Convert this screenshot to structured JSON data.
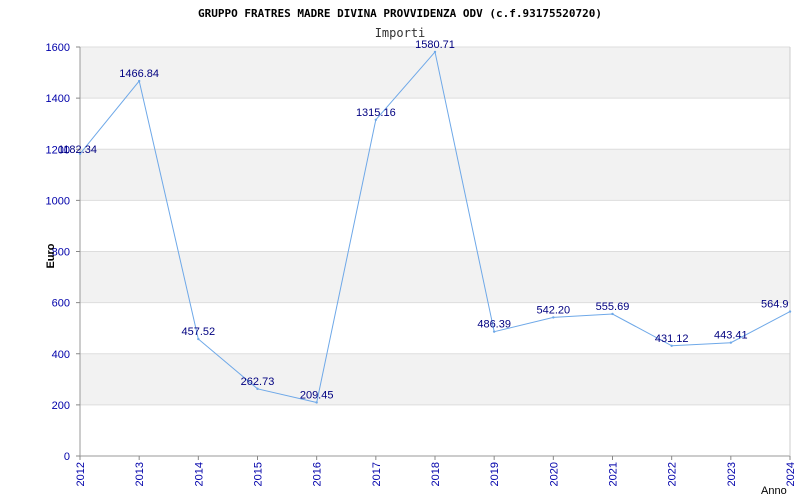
{
  "chart_data": {
    "type": "line",
    "title": "GRUPPO FRATRES MADRE DIVINA PROVVIDENZA ODV (c.f.93175520720)",
    "subtitle": "Importi",
    "xlabel": "Anno",
    "ylabel": "Euro",
    "ylim": [
      0,
      1600
    ],
    "yticks": [
      0,
      200,
      400,
      600,
      800,
      1000,
      1200,
      1400,
      1600
    ],
    "categories": [
      "2012",
      "2013",
      "2014",
      "2015",
      "2016",
      "2017",
      "2018",
      "2019",
      "2020",
      "2021",
      "2022",
      "2023",
      "2024"
    ],
    "values": [
      1182.34,
      1466.84,
      457.52,
      262.73,
      209.45,
      1315.16,
      1580.71,
      486.39,
      542.2,
      555.69,
      431.12,
      443.41,
      564.9
    ],
    "value_labels": [
      "1182.34",
      "1466.84",
      "457.52",
      "262.73",
      "209.45",
      "1315.16",
      "1580.71",
      "486.39",
      "542.20",
      "555.69",
      "431.12",
      "443.41",
      "564.9"
    ],
    "grid": true,
    "grid_band_color": "#f2f2f2",
    "line_color": "#6ea8e8",
    "tick_color": "#0000aa",
    "label_color": "#000080"
  }
}
